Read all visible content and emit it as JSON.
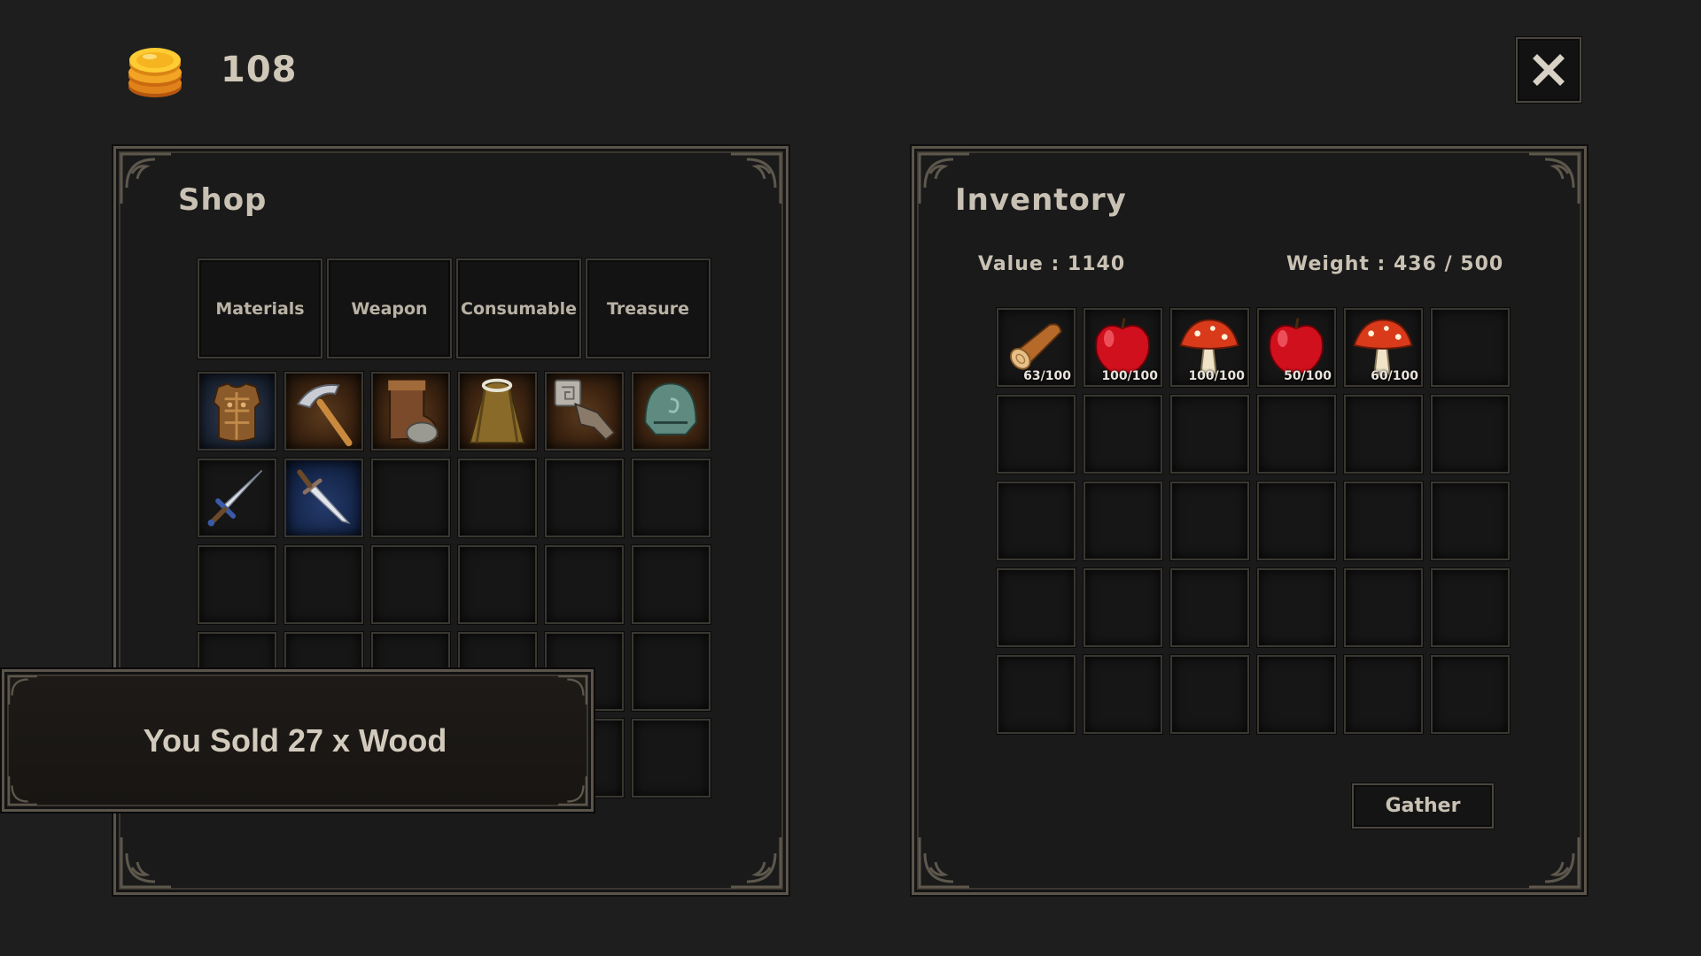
{
  "header": {
    "gold": "108",
    "close_icon": "x-icon"
  },
  "shop": {
    "title": "Shop",
    "tabs": [
      "Materials",
      "Weapon",
      "Consumable",
      "Treasure"
    ],
    "items": [
      {
        "name": "chest-armor-icon",
        "bg": "blue"
      },
      {
        "name": "pickaxe-icon",
        "bg": "warm"
      },
      {
        "name": "boots-icon",
        "bg": "warm"
      },
      {
        "name": "cloak-icon",
        "bg": "warm"
      },
      {
        "name": "gauntlet-icon",
        "bg": "warm"
      },
      {
        "name": "helmet-icon",
        "bg": "warm"
      },
      {
        "name": "sword-icon",
        "bg": "blue"
      },
      {
        "name": "dagger-icon",
        "bg": "deepblue"
      }
    ]
  },
  "inventory": {
    "title": "Inventory",
    "value": "Value :  1140",
    "weight": "Weight :  436 / 500",
    "items": [
      {
        "name": "wood-log-icon",
        "qty": "63/100"
      },
      {
        "name": "red-apple-icon",
        "qty": "100/100"
      },
      {
        "name": "mushroom-icon",
        "qty": "100/100"
      },
      {
        "name": "red-apple-icon",
        "qty": "50/100"
      },
      {
        "name": "mushroom-icon",
        "qty": "60/100"
      }
    ],
    "gather_label": "Gather"
  },
  "toast": {
    "message": "You Sold 27 x Wood"
  },
  "colors": {
    "background": "#1e1e1e",
    "panel_border": "#5a544a",
    "text": "#c9c2b4",
    "gold": "#f0a820"
  }
}
